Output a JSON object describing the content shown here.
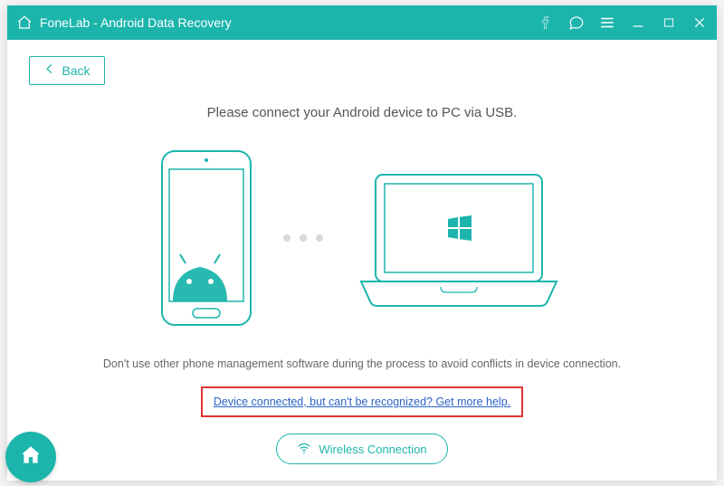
{
  "titlebar": {
    "app_title": "FoneLab - Android Data Recovery"
  },
  "toolbar": {
    "back_label": "Back"
  },
  "main": {
    "instruction": "Please connect your Android device to PC via USB.",
    "warning": "Don't use other phone management software during the process to avoid conflicts in device connection.",
    "help_link": "Device connected, but can't be recognized? Get more help.",
    "wireless_label": "Wireless Connection"
  },
  "colors": {
    "accent": "#1cb5ac",
    "highlight_border": "#e03434",
    "link": "#2b63c5"
  }
}
